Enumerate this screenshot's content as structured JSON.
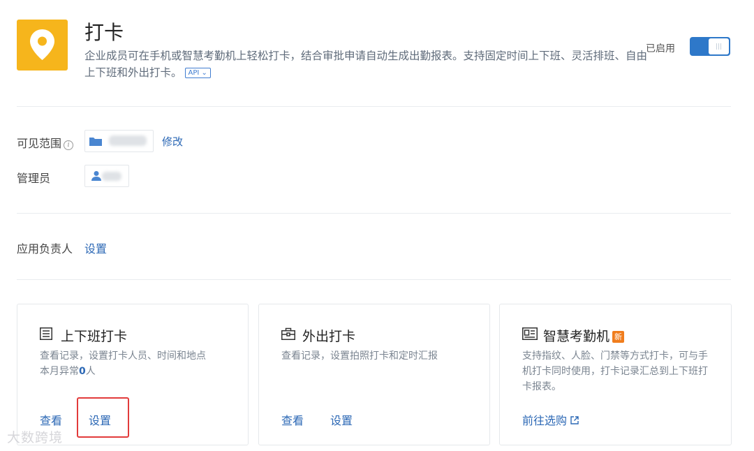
{
  "app": {
    "title": "打卡",
    "description": "企业成员可在手机或智慧考勤机上轻松打卡，结合审批申请自动生成出勤报表。支持固定时间上下班、灵活排班、自由上下班和外出打卡。",
    "api_tag": "API ⌄",
    "status_label": "已启用",
    "enabled": true,
    "icon": "location-pin-icon",
    "icon_color": "#f6b51c"
  },
  "visibility": {
    "label": "可见范围",
    "edit_link": "修改"
  },
  "admin": {
    "label": "管理员"
  },
  "owner": {
    "label": "应用负责人",
    "set_link": "设置"
  },
  "cards": [
    {
      "title": "上下班打卡",
      "icon": "list-icon",
      "description": "查看记录，设置打卡人员、时间和地点",
      "abnormal_prefix": "本月异常",
      "abnormal_count": "0",
      "abnormal_suffix": "人",
      "actions": [
        "查看",
        "设置"
      ]
    },
    {
      "title": "外出打卡",
      "icon": "briefcase-icon",
      "description": "查看记录，设置拍照打卡和定时汇报",
      "actions": [
        "查看",
        "设置"
      ]
    },
    {
      "title": "智慧考勤机",
      "icon": "attendance-machine-icon",
      "badge": "新",
      "description": "支持指纹、人脸、门禁等方式打卡，可与手机打卡同时使用，打卡记录汇总到上下班打卡报表。",
      "action": "前往选购",
      "action_icon": "external-link-icon"
    }
  ],
  "watermark": "大数跨境",
  "accent_color": "#2c68b5",
  "highlight_color": "#e23b3b"
}
